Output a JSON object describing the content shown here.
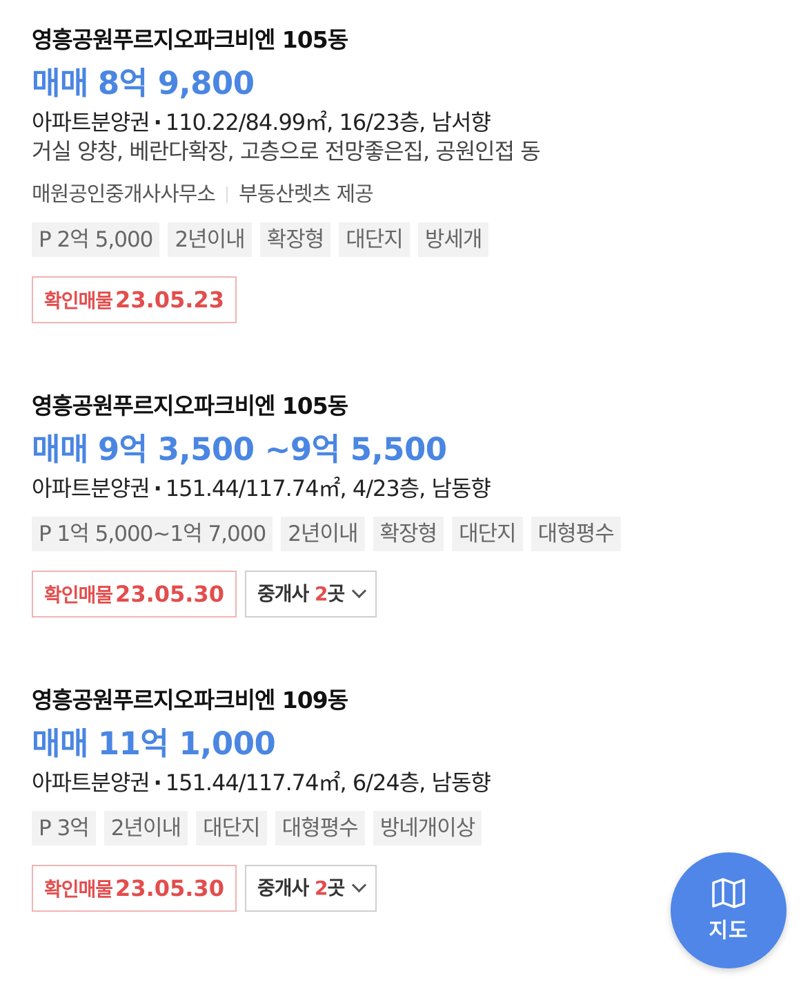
{
  "listings": [
    {
      "title": "영흥공원푸르지오파크비엔 105동",
      "price_prefix": "매매",
      "price_value": "8억 9,800",
      "property_type": "아파트분양권",
      "details": "110.22/84.99㎡, 16/23층, 남서향",
      "description": "거실 양창, 베란다확장, 고층으로 전망좋은집, 공원인접 동",
      "agent": "매원공인중개사사무소",
      "provider": "부동산렛츠 제공",
      "tags": [
        "P 2억 5,000",
        "2년이내",
        "확장형",
        "대단지",
        "방세개"
      ],
      "verified_label": "확인매물",
      "verified_date": "23.05.23"
    },
    {
      "title": "영흥공원푸르지오파크비엔 105동",
      "price_prefix": "매매",
      "price_value": "9억 3,500 ~9억 5,500",
      "property_type": "아파트분양권",
      "details": "151.44/117.74㎡, 4/23층, 남동향",
      "tags": [
        "P 1억 5,000~1억 7,000",
        "2년이내",
        "확장형",
        "대단지",
        "대형평수"
      ],
      "verified_label": "확인매물",
      "verified_date": "23.05.30",
      "brokers_label": "중개사",
      "brokers_count": "2",
      "brokers_unit": "곳"
    },
    {
      "title": "영흥공원푸르지오파크비엔 109동",
      "price_prefix": "매매",
      "price_value": "11억 1,000",
      "property_type": "아파트분양권",
      "details": "151.44/117.74㎡, 6/24층, 남동향",
      "tags": [
        "P 3억",
        "2년이내",
        "대단지",
        "대형평수",
        "방네개이상"
      ],
      "verified_label": "확인매물",
      "verified_date": "23.05.30",
      "brokers_label": "중개사",
      "brokers_count": "2",
      "brokers_unit": "곳"
    }
  ],
  "map_button": {
    "label": "지도",
    "icon": "map-icon",
    "color": "#4f86e8"
  },
  "colors": {
    "price_blue": "#4a86e2",
    "verified_red": "#e34d4d"
  }
}
